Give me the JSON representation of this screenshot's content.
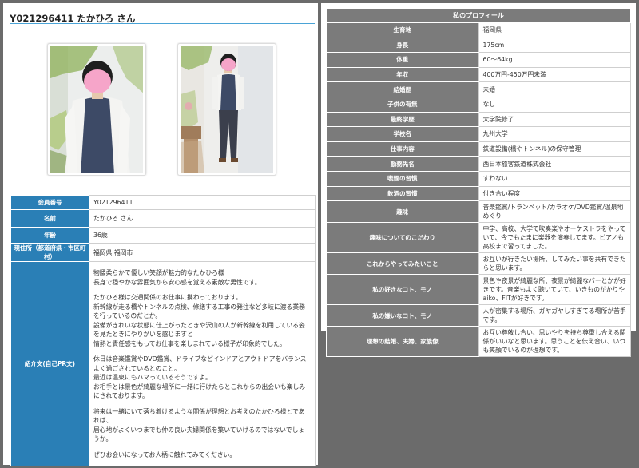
{
  "profile_title": "Y021296411  たかひろ さん",
  "member_table": [
    {
      "label": "会員番号",
      "value": "Y021296411"
    },
    {
      "label": "名前",
      "value": "たかひろ さん"
    },
    {
      "label": "年齢",
      "value": "36歳"
    },
    {
      "label": "現住所（都道府県・市区町村）",
      "value": "福岡県 福岡市"
    },
    {
      "label": "紹介文(自己PR文)",
      "paragraphs": [
        [
          "物腰柔らかで優しい笑顔が魅力的なたかひろ様",
          "長身で穏やかな雰囲気から安心感を覚える素敵な男性です。"
        ],
        [
          "たかひろ様は交通関係のお仕事に携わっております。",
          "新幹線が走る橋やトンネルの点検、修繕する工事の発注など多岐に渡る業務を行っているのだとか。",
          "設備がきれいな状態に仕上がったときや沢山の人が新幹線を利用している姿を見たときにやりがいを感じますと",
          "情熱と責任感をもってお仕事を楽しまれている様子が印象的でした。"
        ],
        [
          "休日は音楽鑑賞やDVD鑑賞、ドライブなどインドアとアウトドアをバランスよく過ごされているとのこと。",
          "最近は温泉にもハマっているそうですよ。",
          "お相手とは景色が綺麗な場所に一緒に行けたらとこれからの出会いも楽しみにされております。"
        ],
        [
          "将来は一緒にいて落ち着けるような関係が理想とお考えのたかひろ様とであれば、",
          "居心地がよくいつまでも仲の良い夫婦関係を築いていけるのではないでしょうか。"
        ],
        [
          "ぜひお会いになってお人柄に触れてみてください。"
        ]
      ]
    }
  ],
  "right_panel": {
    "title": "私のプロフィール",
    "rows": [
      {
        "label": "生育地",
        "value": "福岡県"
      },
      {
        "label": "身長",
        "value": "175cm"
      },
      {
        "label": "体重",
        "value": "60～64kg"
      },
      {
        "label": "年収",
        "value": "400万円-450万円未満"
      },
      {
        "label": "結婚歴",
        "value": "未婚"
      },
      {
        "label": "子供の有無",
        "value": "なし"
      },
      {
        "label": "最終学歴",
        "value": "大学院修了"
      },
      {
        "label": "学校名",
        "value": "九州大学"
      },
      {
        "label": "仕事内容",
        "value": "鉄道設備(橋やトンネル)の保守管理"
      },
      {
        "label": "勤務先名",
        "value": "西日本旅客鉄道株式会社"
      },
      {
        "label": "喫煙の習慣",
        "value": "すわない"
      },
      {
        "label": "飲酒の習慣",
        "value": "付き合い程度"
      },
      {
        "label": "趣味",
        "value": "音楽鑑賞/トランペット/カラオケ/DVD鑑賞/温泉地めぐり"
      },
      {
        "label": "趣味についてのこだわり",
        "value": "中学、高校、大学で吹奏楽やオーケストラをやっていて、今でもたまに楽器を演奏してます。ピアノも高校まで習ってました。"
      },
      {
        "label": "これからやってみたいこと",
        "value": "お互いが行きたい場所、してみたい事を共有できたらと思います。"
      },
      {
        "label": "私の好きなコト、モノ",
        "value": "景色や夜景が綺麗な所、夜景が綺麗なバーとかが好きです。音楽もよく聴いていて、いきものがかりやaiko、FITが好きです。"
      },
      {
        "label": "私の嫌いなコト、モノ",
        "value": "人が密集する場所、ガヤガヤしすぎてる場所が苦手です。"
      },
      {
        "label": "理想の結婚、夫婦、家族像",
        "value": "お互い尊敬し合い、思いやりを持ち尊重し合える関係がいいなと思います。思うことを伝え合い、いつも笑顔でいるのが理想です。"
      }
    ]
  }
}
